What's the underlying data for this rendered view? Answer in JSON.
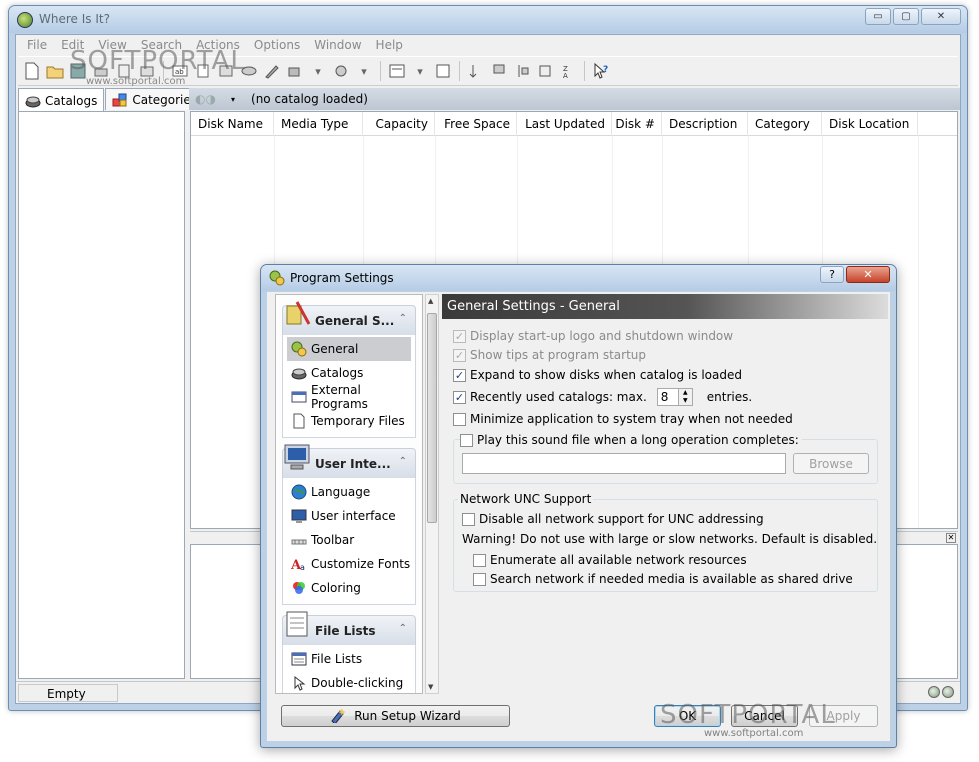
{
  "main_window": {
    "title": "Where Is It?",
    "controls": {
      "minimize": "▭",
      "maximize": "▢",
      "close": "✕"
    }
  },
  "menu": [
    "File",
    "Edit",
    "View",
    "Search",
    "Actions",
    "Options",
    "Window",
    "Help"
  ],
  "tabs": {
    "catalogs": "Catalogs",
    "categories": "Categories"
  },
  "catalog_bar": {
    "caption": "(no catalog loaded)"
  },
  "columns": [
    "Disk Name",
    "Media Type",
    "Capacity",
    "Free Space",
    "Last Updated",
    "Disk #",
    "Description",
    "Category",
    "Disk Location"
  ],
  "status": {
    "text": "Empty"
  },
  "watermark": {
    "text": "SOFTPORTAL",
    "url": "www.softportal.com"
  },
  "dialog": {
    "title": "Program Settings",
    "help": "?",
    "close": "✕",
    "section_header": "General Settings - General",
    "nav_groups": [
      {
        "title": "General S...",
        "items": [
          "General",
          "Catalogs",
          "External Programs",
          "Temporary Files"
        ]
      },
      {
        "title": "User Inte...",
        "items": [
          "Language",
          "User interface",
          "Toolbar",
          "Customize Fonts",
          "Coloring"
        ]
      },
      {
        "title": "File Lists",
        "items": [
          "File Lists",
          "Double-clicking"
        ]
      }
    ],
    "options": {
      "startup_logo": "Display start-up logo and shutdown window",
      "show_tips": "Show tips at program startup",
      "expand_disks": "Expand to show disks when catalog is loaded",
      "recent_catalogs": "Recently used catalogs: max.",
      "recent_value": "8",
      "recent_suffix": "entries.",
      "minimize_tray": "Minimize application to system tray when not needed",
      "play_sound": "Play this sound file when a long operation completes:",
      "sound_path": ""
    },
    "network_group": {
      "title": "Network UNC Support",
      "disable_unc": "Disable all network support for UNC addressing",
      "warning": "Warning! Do not use with large or slow networks. Default is disabled.",
      "enumerate": "Enumerate all available network resources",
      "search_shared": "Search network if needed media is available as shared drive"
    },
    "buttons": {
      "browse": "Browse",
      "wizard": "Run Setup Wizard",
      "ok": "OK",
      "cancel": "Cancel",
      "apply": "Apply"
    }
  }
}
